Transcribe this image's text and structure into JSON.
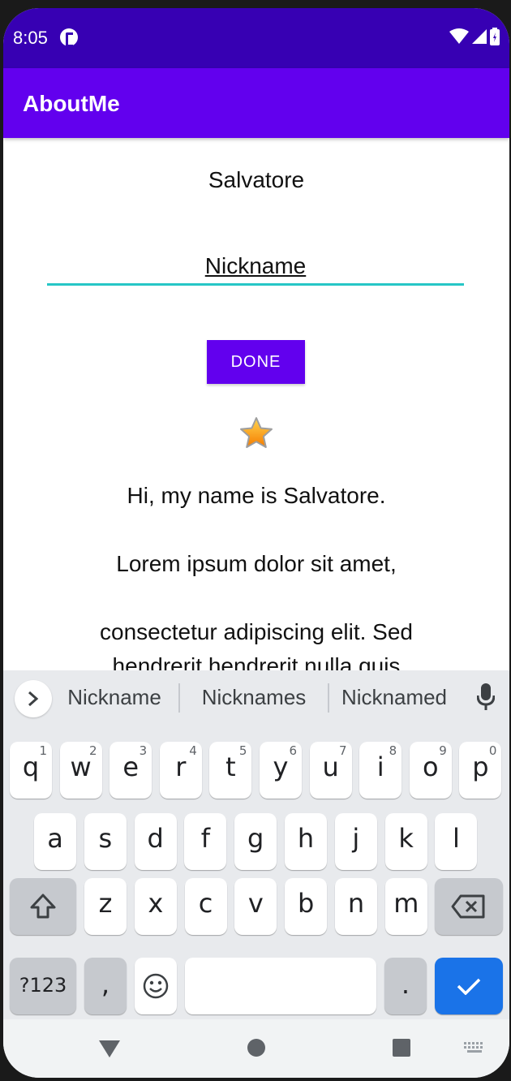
{
  "status_bar": {
    "time": "8:05"
  },
  "app_bar": {
    "title": "AboutMe"
  },
  "content": {
    "name": "Salvatore",
    "nickname_value": "Nickname",
    "done_label": "DONE",
    "bio": [
      "Hi, my name is Salvatore.",
      "Lorem ipsum dolor sit amet,",
      "consectetur adipiscing elit. Sed hendrerit hendrerit nulla quis"
    ]
  },
  "keyboard": {
    "suggestions": [
      "Nickname",
      "Nicknames",
      "Nicknamed"
    ],
    "row1": [
      {
        "k": "q",
        "h": "1"
      },
      {
        "k": "w",
        "h": "2"
      },
      {
        "k": "e",
        "h": "3"
      },
      {
        "k": "r",
        "h": "4"
      },
      {
        "k": "t",
        "h": "5"
      },
      {
        "k": "y",
        "h": "6"
      },
      {
        "k": "u",
        "h": "7"
      },
      {
        "k": "i",
        "h": "8"
      },
      {
        "k": "o",
        "h": "9"
      },
      {
        "k": "p",
        "h": "0"
      }
    ],
    "row2": [
      "a",
      "s",
      "d",
      "f",
      "g",
      "h",
      "j",
      "k",
      "l"
    ],
    "row3": [
      "z",
      "x",
      "c",
      "v",
      "b",
      "n",
      "m"
    ],
    "symbols_label": "?123",
    "comma_label": ",",
    "period_label": "."
  },
  "colors": {
    "status_bar": "#3700b3",
    "app_bar": "#6200ee",
    "button": "#6200ee",
    "field_underline": "#26c6c6",
    "enter_key": "#1a73e8"
  },
  "icons": {
    "status": [
      "app-notification-icon",
      "wifi-icon",
      "signal-icon",
      "battery-icon"
    ],
    "star": "star-icon",
    "keyboard": [
      "expand-suggestions-icon",
      "mic-icon",
      "shift-icon",
      "backspace-icon",
      "emoji-icon",
      "enter-check-icon"
    ],
    "nav": [
      "back-icon",
      "home-icon",
      "recents-icon",
      "keyboard-switch-icon"
    ]
  }
}
